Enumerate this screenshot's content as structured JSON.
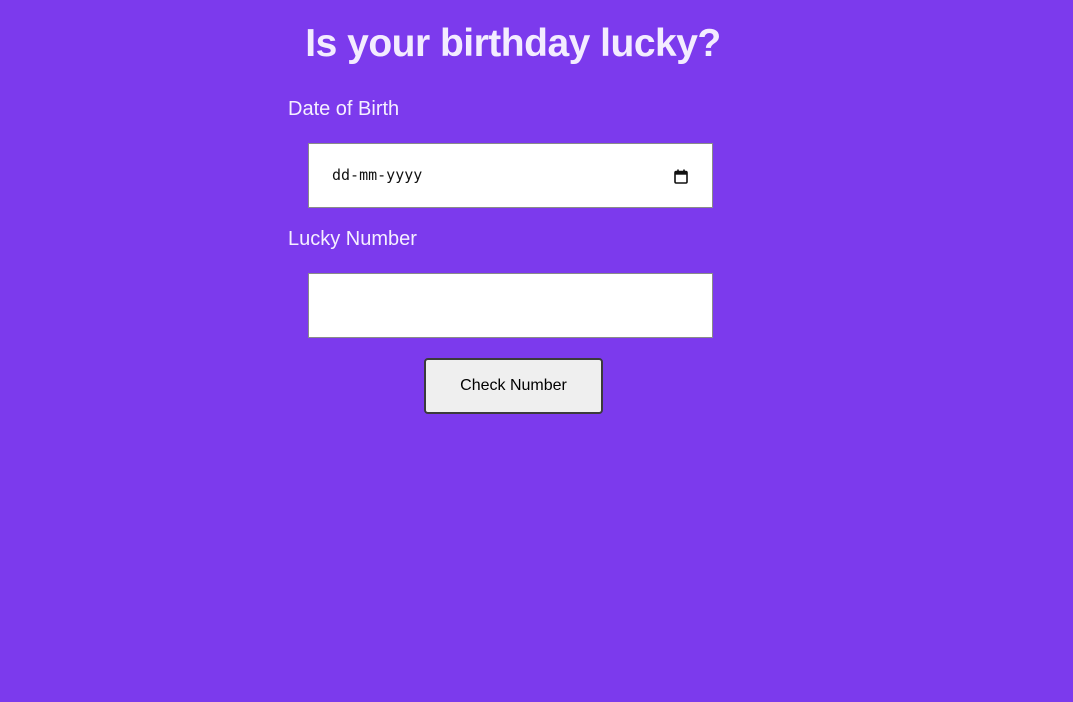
{
  "page": {
    "title": "Is your birthday lucky?",
    "background_color": "#7c3aed"
  },
  "form": {
    "dob": {
      "label": "Date of Birth",
      "placeholder": "dd-mm-yyyy",
      "value": "",
      "icon": "calendar-icon"
    },
    "lucky_number": {
      "label": "Lucky Number",
      "value": "",
      "placeholder": ""
    },
    "submit_label": "Check Number"
  }
}
